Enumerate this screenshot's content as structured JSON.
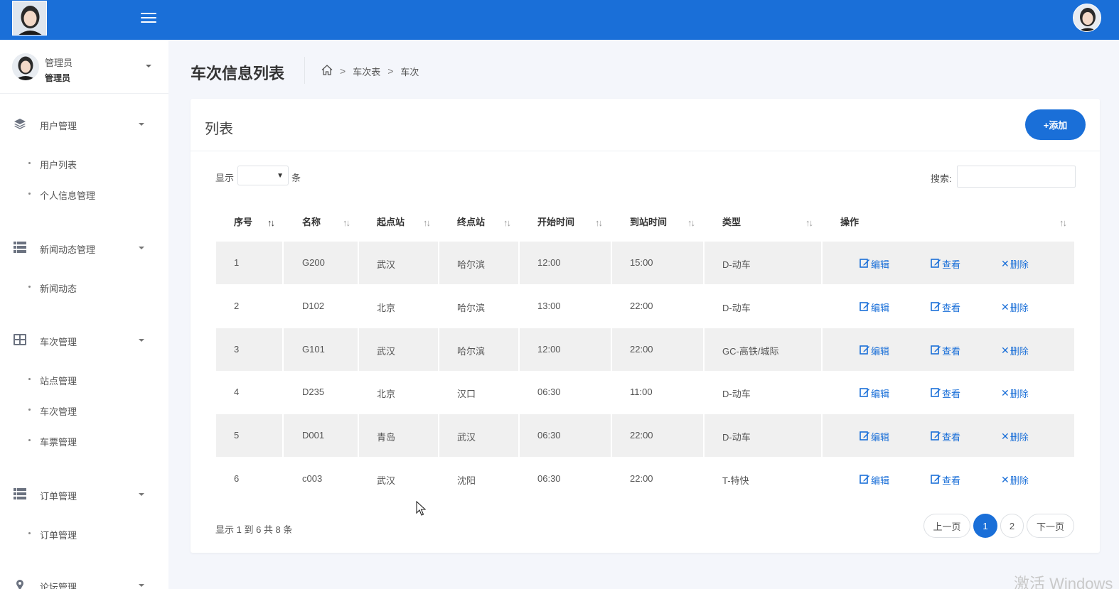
{
  "sidebar": {
    "user": {
      "name": "管理员",
      "role": "管理员"
    },
    "groups": [
      {
        "label": "用户管理",
        "icon": "layers-icon",
        "items": [
          "用户列表",
          "个人信息管理"
        ]
      },
      {
        "label": "新闻动态管理",
        "icon": "list-icon",
        "items": [
          "新闻动态"
        ]
      },
      {
        "label": "车次管理",
        "icon": "grid-icon",
        "items": [
          "站点管理",
          "车次管理",
          "车票管理"
        ]
      },
      {
        "label": "订单管理",
        "icon": "list-icon",
        "items": [
          "订单管理"
        ]
      },
      {
        "label": "论坛管理",
        "icon": "pin-icon",
        "items": []
      }
    ]
  },
  "page": {
    "title": "车次信息列表",
    "breadcrumb": [
      "车次表",
      "车次"
    ]
  },
  "card": {
    "title": "列表",
    "add_label": "+添加",
    "show_label": "显示",
    "show_unit": "条",
    "search_label": "搜索:",
    "search_value": ""
  },
  "table": {
    "columns": [
      "序号",
      "名称",
      "起点站",
      "终点站",
      "开始时间",
      "到站时间",
      "类型",
      "操作"
    ],
    "rows": [
      [
        "1",
        "G200",
        "武汉",
        "哈尔滨",
        "12:00",
        "15:00",
        "D-动车"
      ],
      [
        "2",
        "D102",
        "北京",
        "哈尔滨",
        "13:00",
        "22:00",
        "D-动车"
      ],
      [
        "3",
        "G101",
        "武汉",
        "哈尔滨",
        "12:00",
        "22:00",
        "GC-高铁/城际"
      ],
      [
        "4",
        "D235",
        "北京",
        "汉口",
        "06:30",
        "11:00",
        "D-动车"
      ],
      [
        "5",
        "D001",
        "青岛",
        "武汉",
        "06:30",
        "22:00",
        "D-动车"
      ],
      [
        "6",
        "c003",
        "武汉",
        "沈阳",
        "06:30",
        "22:00",
        "T-特快"
      ]
    ],
    "actions": {
      "edit": "编辑",
      "view": "查看",
      "delete": "删除"
    }
  },
  "footer": {
    "info": "显示 1 到 6 共 8 条",
    "prev": "上一页",
    "pages": [
      "1",
      "2"
    ],
    "current_page": "1",
    "next": "下一页"
  },
  "watermark": "激活 Windows",
  "colors": {
    "primary": "#1a6fd8",
    "row_stripe": "#f0f0f0",
    "background": "#f4f6fb"
  }
}
